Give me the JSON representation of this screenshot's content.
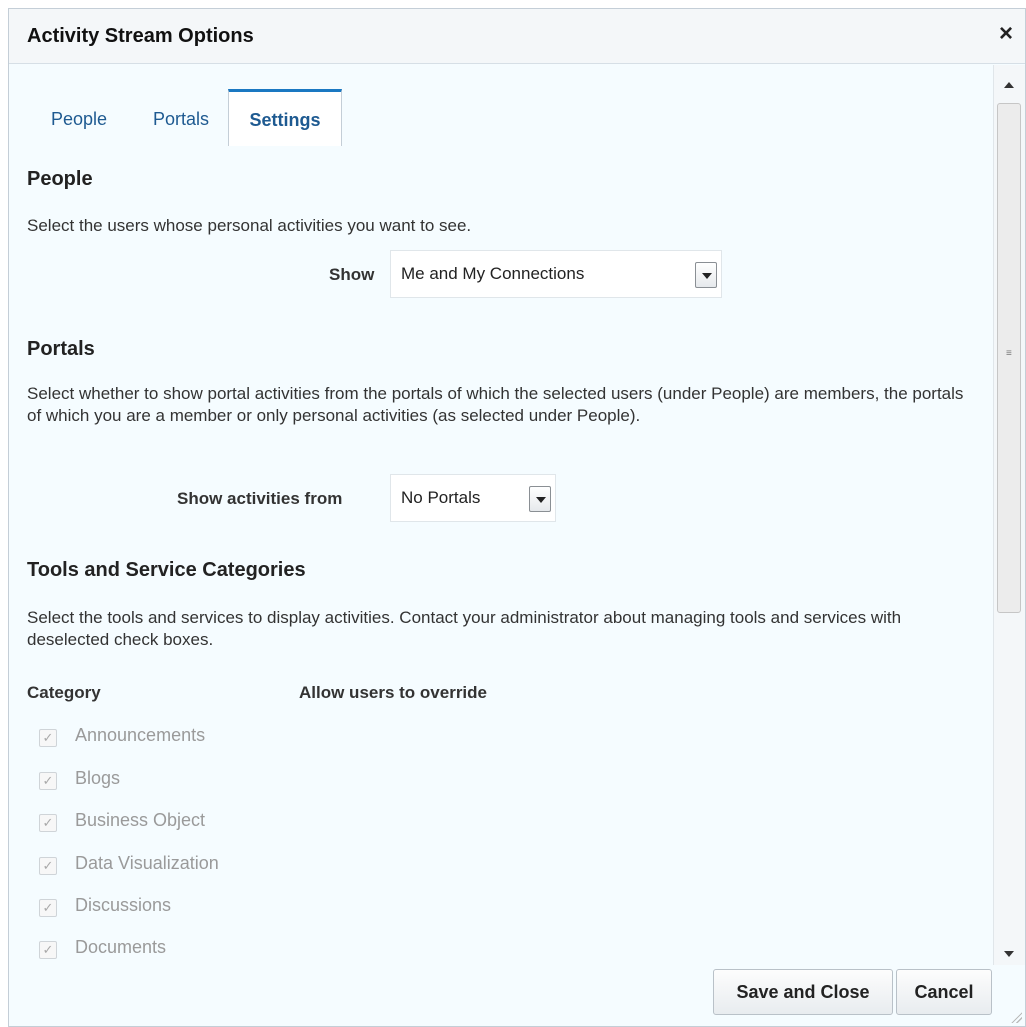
{
  "dialog": {
    "title": "Activity Stream Options",
    "close_icon": "×"
  },
  "tabs": [
    {
      "label": "People",
      "selected": false
    },
    {
      "label": "Portals",
      "selected": false
    },
    {
      "label": "Settings",
      "selected": true
    }
  ],
  "people_section": {
    "heading": "People",
    "description": "Select the users whose personal activities you want to see.",
    "show_label": "Show",
    "show_value": "Me and My Connections"
  },
  "portals_section": {
    "heading": "Portals",
    "description": "Select whether to show portal activities from the portals of which the selected users (under People) are members, the portals of which you are a member or only personal activities (as selected under People).",
    "show_label": "Show activities from",
    "show_value": "No Portals"
  },
  "tools_section": {
    "heading": "Tools and Service Categories",
    "description": "Select the tools and services to display activities. Contact your administrator about managing tools and services with deselected check boxes.",
    "column_category": "Category",
    "column_override": "Allow users to override",
    "categories": [
      {
        "label": "Announcements",
        "checked": true,
        "disabled": true
      },
      {
        "label": "Blogs",
        "checked": true,
        "disabled": true
      },
      {
        "label": "Business Object",
        "checked": true,
        "disabled": true
      },
      {
        "label": "Data Visualization",
        "checked": true,
        "disabled": true
      },
      {
        "label": "Discussions",
        "checked": true,
        "disabled": true
      },
      {
        "label": "Documents",
        "checked": true,
        "disabled": true
      }
    ]
  },
  "buttons": {
    "save_label": "Save and Close",
    "cancel_label": "Cancel"
  },
  "icons": {
    "check": "✓",
    "grip": "≡"
  },
  "colors": {
    "accent": "#1a78c2",
    "link": "#1e5a91",
    "panel_bg": "#f5fcff",
    "disabled_text": "#9a9a9a"
  }
}
